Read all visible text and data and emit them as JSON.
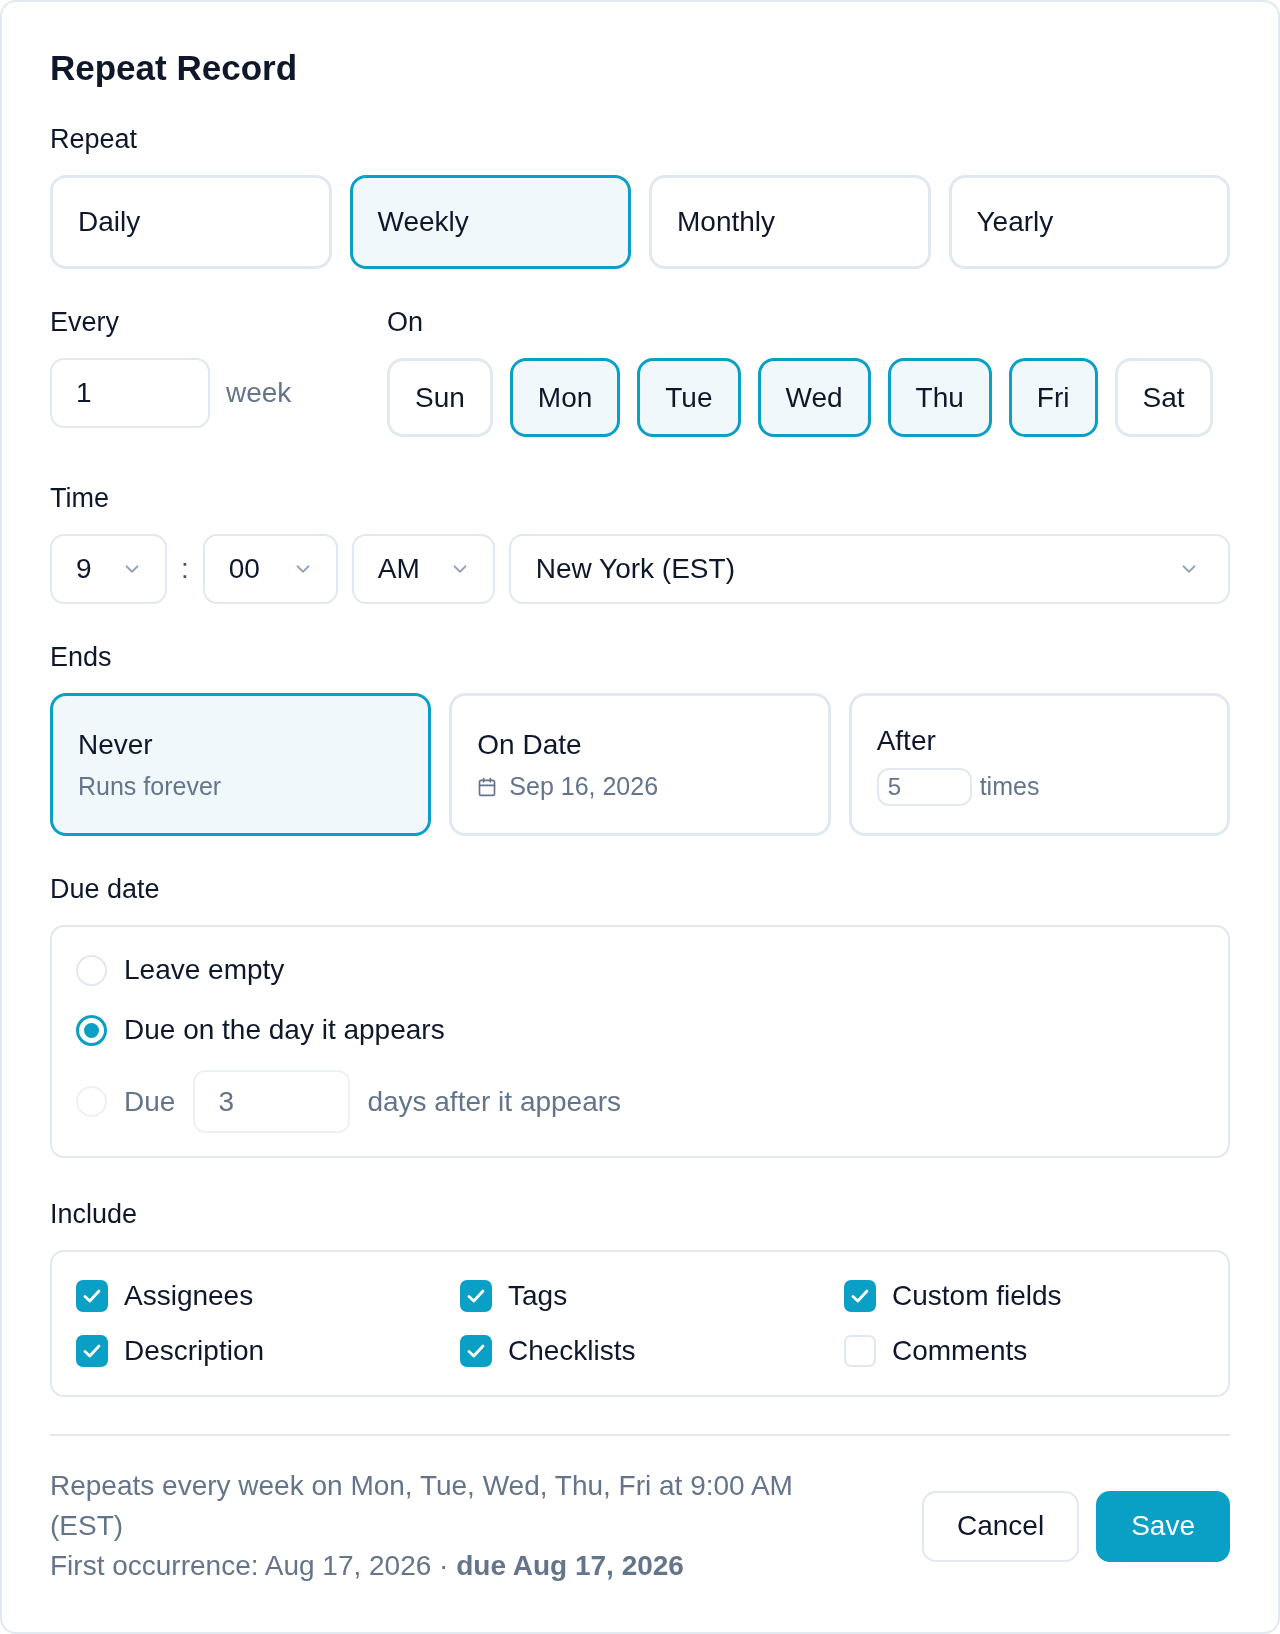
{
  "dialog": {
    "title": "Repeat Record"
  },
  "repeat": {
    "label": "Repeat",
    "options": [
      {
        "label": "Daily",
        "selected": false
      },
      {
        "label": "Weekly",
        "selected": true
      },
      {
        "label": "Monthly",
        "selected": false
      },
      {
        "label": "Yearly",
        "selected": false
      }
    ]
  },
  "every": {
    "label": "Every",
    "value": "1",
    "unit": "week"
  },
  "on": {
    "label": "On",
    "days": [
      {
        "label": "Sun",
        "selected": false
      },
      {
        "label": "Mon",
        "selected": true
      },
      {
        "label": "Tue",
        "selected": true
      },
      {
        "label": "Wed",
        "selected": true
      },
      {
        "label": "Thu",
        "selected": true
      },
      {
        "label": "Fri",
        "selected": true
      },
      {
        "label": "Sat",
        "selected": false
      }
    ]
  },
  "time": {
    "label": "Time",
    "hour": "9",
    "separator": ":",
    "minute": "00",
    "period": "AM",
    "timezone": "New York (EST)"
  },
  "ends": {
    "label": "Ends",
    "options": [
      {
        "kind": "never",
        "title": "Never",
        "subtitle": "Runs forever",
        "selected": true
      },
      {
        "kind": "date",
        "title": "On Date",
        "date": "Sep 16, 2026",
        "selected": false
      },
      {
        "kind": "count",
        "title": "After",
        "value": "5",
        "unit": "times",
        "selected": false
      }
    ]
  },
  "due_date": {
    "label": "Due date",
    "options": [
      {
        "kind": "plain",
        "label": "Leave empty",
        "selected": false,
        "disabled": false
      },
      {
        "kind": "plain",
        "label": "Due on the day it appears",
        "selected": true,
        "disabled": false
      },
      {
        "kind": "days",
        "label": "Due",
        "value": "3",
        "suffix": "days after it appears",
        "selected": false,
        "disabled": true
      }
    ]
  },
  "include": {
    "label": "Include",
    "items": [
      {
        "label": "Assignees",
        "checked": true
      },
      {
        "label": "Tags",
        "checked": true
      },
      {
        "label": "Custom fields",
        "checked": true
      },
      {
        "label": "Description",
        "checked": true
      },
      {
        "label": "Checklists",
        "checked": true
      },
      {
        "label": "Comments",
        "checked": false
      }
    ]
  },
  "summary": {
    "text": "Repeats every week on Mon, Tue, Wed, Thu, Fri at 9:00 AM (EST)",
    "occurrence": "First occurrence: Aug 17, 2026 · **due Aug 17, 2026**"
  },
  "buttons": [
    {
      "label": "Cancel",
      "kind": "secondary"
    },
    {
      "label": "Save",
      "kind": "primary"
    }
  ]
}
